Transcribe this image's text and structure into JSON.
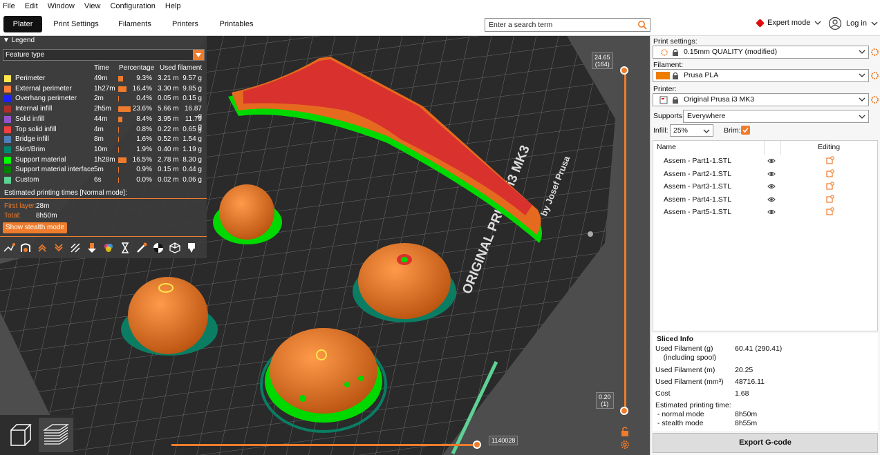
{
  "menu": [
    "File",
    "Edit",
    "Window",
    "View",
    "Configuration",
    "Help"
  ],
  "tabs": [
    "Plater",
    "Print Settings",
    "Filaments",
    "Printers",
    "Printables"
  ],
  "search": {
    "placeholder": "Enter a search term"
  },
  "mode": {
    "label": "Expert mode",
    "color": "#e20b0b"
  },
  "login": {
    "label": "Log in"
  },
  "accent": "#ee7c2c",
  "legend": {
    "title": "Legend",
    "view_type": "Feature type",
    "headers": {
      "time": "Time",
      "percentage": "Percentage",
      "filament": "Used filament"
    },
    "rows": [
      {
        "name": "Perimeter",
        "color": "#ffe64d",
        "time": "49m",
        "pct": "9.3%",
        "pct_value": 9.3,
        "len": "3.21 m",
        "weight": "9.57 g"
      },
      {
        "name": "External perimeter",
        "color": "#ff7d38",
        "time": "1h27m",
        "pct": "16.4%",
        "pct_value": 16.4,
        "len": "3.30 m",
        "weight": "9.85 g"
      },
      {
        "name": "Overhang perimeter",
        "color": "#1f1fff",
        "time": "2m",
        "pct": "0.4%",
        "pct_value": 0.4,
        "len": "0.05 m",
        "weight": "0.15 g"
      },
      {
        "name": "Internal infill",
        "color": "#b03029",
        "time": "2h5m",
        "pct": "23.6%",
        "pct_value": 23.6,
        "len": "5.66 m",
        "weight": "16.87 g"
      },
      {
        "name": "Solid infill",
        "color": "#9654cc",
        "time": "44m",
        "pct": "8.4%",
        "pct_value": 8.4,
        "len": "3.95 m",
        "weight": "11.79 g"
      },
      {
        "name": "Top solid infill",
        "color": "#f04040",
        "time": "4m",
        "pct": "0.8%",
        "pct_value": 0.8,
        "len": "0.22 m",
        "weight": "0.65 g"
      },
      {
        "name": "Bridge infill",
        "color": "#4d80ba",
        "time": "8m",
        "pct": "1.6%",
        "pct_value": 1.6,
        "len": "0.52 m",
        "weight": "1.54 g"
      },
      {
        "name": "Skirt/Brim",
        "color": "#00876e",
        "time": "10m",
        "pct": "1.9%",
        "pct_value": 1.9,
        "len": "0.40 m",
        "weight": "1.19 g"
      },
      {
        "name": "Support material",
        "color": "#00ff00",
        "time": "1h28m",
        "pct": "16.5%",
        "pct_value": 16.5,
        "len": "2.78 m",
        "weight": "8.30 g"
      },
      {
        "name": "Support material interface",
        "color": "#008000",
        "time": "5m",
        "pct": "0.9%",
        "pct_value": 0.9,
        "len": "0.15 m",
        "weight": "0.44 g"
      },
      {
        "name": "Custom",
        "color": "#5ed194",
        "time": "6s",
        "pct": "0.0%",
        "pct_value": 0.0,
        "len": "0.02 m",
        "weight": "0.06 g"
      }
    ],
    "est_title": "Estimated printing times [Normal mode]:",
    "first_layer_label": "First layer:",
    "first_layer": "28m",
    "total_label": "Total:",
    "total": "8h50m",
    "stealth_btn": "Show stealth mode"
  },
  "bed_text": {
    "line1": "ORIGINAL PRUSA i3 MK3",
    "line2": "by Josef Prusa"
  },
  "vslider": {
    "top_value": "24.65",
    "top_layer": "(164)",
    "bottom_value": "0.20",
    "bottom_layer": "(1)"
  },
  "hslider": {
    "value": "1140028"
  },
  "sidebar": {
    "print_label": "Print settings:",
    "print_value": "0.15mm QUALITY (modified)",
    "filament_label": "Filament:",
    "filament_value": "Prusa PLA",
    "filament_color": "#ee7c00",
    "printer_label": "Printer:",
    "printer_value": "Original Prusa i3 MK3",
    "supports_label": "Supports:",
    "supports_value": "Everywhere",
    "infill_label": "Infill:",
    "infill_value": "25%",
    "brim_label": "Brim:",
    "brim_checked": true,
    "col_name": "Name",
    "col_editing": "Editing",
    "objects": [
      "Assem - Part1-1.STL",
      "Assem - Part2-1.STL",
      "Assem - Part3-1.STL",
      "Assem - Part4-1.STL",
      "Assem - Part5-1.STL"
    ]
  },
  "sliced": {
    "title": "Sliced Info",
    "rows": [
      {
        "label": "Used Filament (g)",
        "value": "60.41 (290.41)"
      },
      {
        "label": "    (including spool)",
        "value": ""
      },
      {
        "label": "Used Filament (m)",
        "value": "20.25"
      },
      {
        "label": "Used Filament (mm³)",
        "value": "48716.11"
      },
      {
        "label": "Cost",
        "value": "1.68"
      },
      {
        "label": "Estimated printing time:",
        "value": ""
      },
      {
        "label": " - normal mode",
        "value": "8h50m"
      },
      {
        "label": " - stealth mode",
        "value": "8h55m"
      }
    ]
  },
  "export_btn": "Export G-code"
}
